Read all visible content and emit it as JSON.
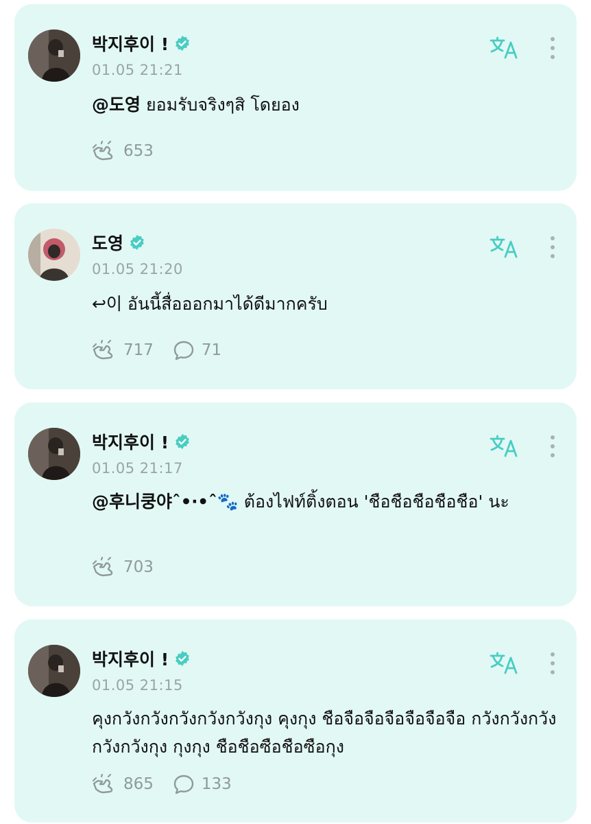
{
  "posts": [
    {
      "author": "박지후이 !",
      "time": "01.05 21:21",
      "mention": "@도영",
      "body": " ยอมรับจริงๆสิ โดยอง",
      "likes": "653",
      "comments": null
    },
    {
      "author": "도영",
      "time": "01.05 21:20",
      "mention": "",
      "body": "↩이 อันนี้สื่อออกมาได้ดีมากครับ",
      "likes": "717",
      "comments": "71"
    },
    {
      "author": "박지후이 !",
      "time": "01.05 21:17",
      "mention": "@후니쿵야ˆ•‧•ˆ🐾",
      "body": " ต้องไฟท์ติ้งตอน 'ชือชือชือชือชือ' นะ",
      "likes": "703",
      "comments": null
    },
    {
      "author": "박지후이 !",
      "time": "01.05 21:15",
      "mention": "",
      "body": "คุงกวังกวังกวังกวังกวังกุง คุงกุง ชือจือจือจือจือจือจือ กวังกวังกวัง กวังกวังกุง กุงกุง ชือชือซือชือซือกุง",
      "likes": "865",
      "comments": "133"
    }
  ],
  "icons": {
    "translate": "translate-icon",
    "more": "more-vertical-icon",
    "like": "like-icon",
    "comment": "comment-icon",
    "verified": "verified-badge-icon"
  },
  "colors": {
    "card_background": "#e2f8f5",
    "accent": "#49cdc3",
    "muted": "#8f9a99"
  }
}
